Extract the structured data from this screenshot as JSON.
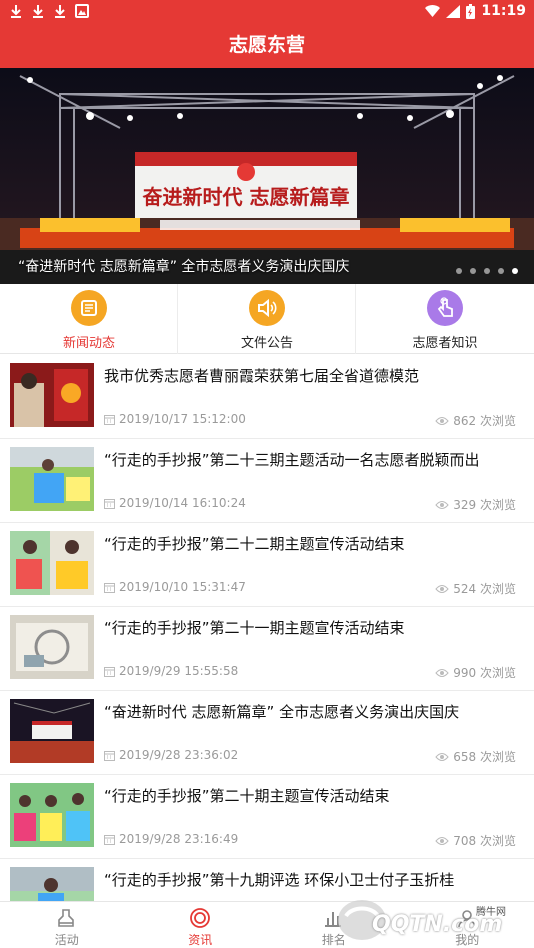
{
  "status_bar": {
    "time": "11:19",
    "battery_icon": "battery-charging-icon",
    "signal_icon": "signal-icon",
    "wifi_icon": "wifi-icon"
  },
  "app_bar": {
    "title": "志愿东营"
  },
  "banner": {
    "caption": "“奋进新时代 志愿新篇章” 全市志愿者义务演出庆国庆",
    "stage_text": "奋进新时代 志愿新篇章",
    "dots": 5,
    "active_dot": 4
  },
  "categories": [
    {
      "label": "新闻动态",
      "icon": "newspaper-icon",
      "color": "#f5a623",
      "active": true
    },
    {
      "label": "文件公告",
      "icon": "speaker-icon",
      "color": "#f5a623",
      "active": false
    },
    {
      "label": "志愿者知识",
      "icon": "touch-hand-icon",
      "color": "#a97ae8",
      "active": false
    }
  ],
  "news": [
    {
      "title": "我市优秀志愿者曹丽霞荣获第七届全省道德模范",
      "date": "2019/10/17 15:12:00",
      "views": "862 次浏览"
    },
    {
      "title": "“行走的手抄报”第二十三期主题活动一名志愿者脱颖而出",
      "date": "2019/10/14 16:10:24",
      "views": "329 次浏览"
    },
    {
      "title": "“行走的手抄报”第二十二期主题宣传活动结束",
      "date": "2019/10/10 15:31:47",
      "views": "524 次浏览"
    },
    {
      "title": "“行走的手抄报”第二十一期主题宣传活动结束",
      "date": "2019/9/29 15:55:58",
      "views": "990 次浏览"
    },
    {
      "title": "“奋进新时代 志愿新篇章” 全市志愿者义务演出庆国庆",
      "date": "2019/9/28 23:36:02",
      "views": "658 次浏览"
    },
    {
      "title": "“行走的手抄报”第二十期主题宣传活动结束",
      "date": "2019/9/28 23:16:49",
      "views": "708 次浏览"
    },
    {
      "title": "“行走的手抄报”第十九期评选 环保小卫士付子玉折桂",
      "date": "",
      "views": ""
    }
  ],
  "bottom_nav": [
    {
      "label": "活动",
      "icon": "activity-icon",
      "active": false
    },
    {
      "label": "资讯",
      "icon": "news-target-icon",
      "active": true
    },
    {
      "label": "排名",
      "icon": "ranking-icon",
      "active": false
    },
    {
      "label": "我的",
      "icon": "profile-icon",
      "active": false
    }
  ],
  "watermark": {
    "text": "QQTN.com",
    "small": "腾牛网"
  },
  "colors": {
    "primary": "#e53935",
    "accent_orange": "#f5a623",
    "accent_purple": "#a97ae8"
  }
}
